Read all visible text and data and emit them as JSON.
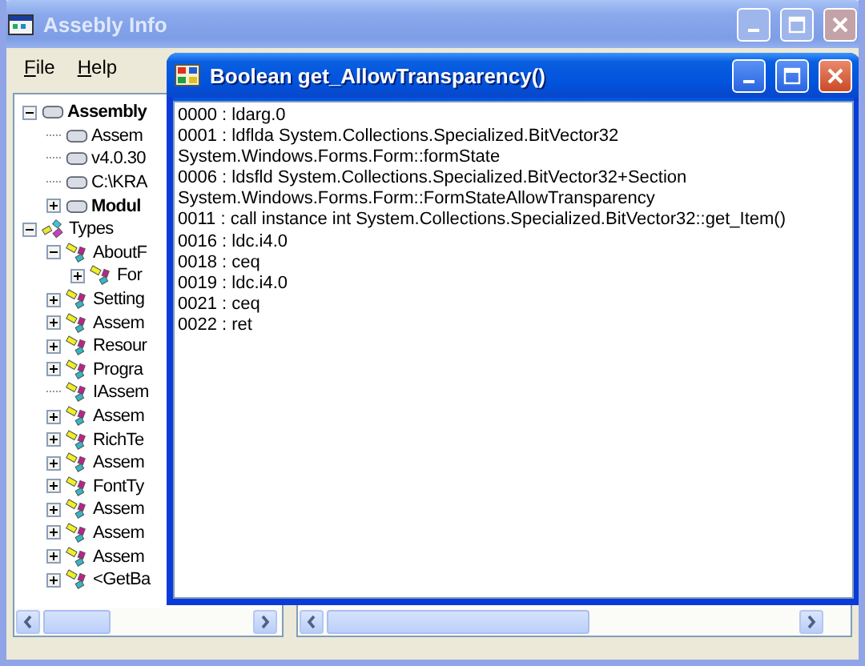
{
  "window": {
    "title": "Assebly Info"
  },
  "menu": [
    {
      "label": "File"
    },
    {
      "label": "Help"
    }
  ],
  "tree": [
    {
      "label": "Assembly",
      "kind": "group",
      "expanded": true,
      "children": [
        {
          "label": "Assem",
          "kind": "item"
        },
        {
          "label": "v4.0.30",
          "kind": "item"
        },
        {
          "label": "C:\\KRA",
          "kind": "item"
        },
        {
          "label": "Modul",
          "kind": "group",
          "expanded": false
        }
      ]
    },
    {
      "label": "Types",
      "kind": "namespace",
      "expanded": true,
      "children": [
        {
          "label": "AboutF",
          "kind": "class",
          "expanded": true,
          "children": [
            {
              "label": "For",
              "kind": "class",
              "expanded": false
            }
          ]
        },
        {
          "label": "Setting",
          "kind": "class",
          "expanded": false
        },
        {
          "label": "Assem",
          "kind": "class",
          "expanded": false
        },
        {
          "label": "Resour",
          "kind": "class",
          "expanded": false
        },
        {
          "label": "Progra",
          "kind": "class",
          "expanded": false
        },
        {
          "label": "IAssem",
          "kind": "class"
        },
        {
          "label": "Assem",
          "kind": "class",
          "expanded": false
        },
        {
          "label": "RichTe",
          "kind": "class",
          "expanded": false
        },
        {
          "label": "Assem",
          "kind": "class",
          "expanded": false
        },
        {
          "label": "FontTy",
          "kind": "class",
          "expanded": false
        },
        {
          "label": "Assem",
          "kind": "class",
          "expanded": false
        },
        {
          "label": "Assem",
          "kind": "class",
          "expanded": false
        },
        {
          "label": "Assem",
          "kind": "class",
          "expanded": false
        },
        {
          "label": "<GetBa",
          "kind": "class",
          "expanded": false
        }
      ]
    }
  ],
  "dialog": {
    "title": "Boolean get_AllowTransparency()",
    "lines": [
      "0000 : ldarg.0",
      "0001 : ldflda System.Collections.Specialized.BitVector32",
      "System.Windows.Forms.Form::formState",
      "0006 : ldsfld System.Collections.Specialized.BitVector32+Section",
      "System.Windows.Forms.Form::FormStateAllowTransparency",
      "0011 : call instance int System.Collections.Specialized.BitVector32::get_Item()",
      "0016 : ldc.i4.0",
      "0018 : ceq",
      "0019 : ldc.i4.0",
      "0021 : ceq",
      "0022 : ret"
    ]
  }
}
